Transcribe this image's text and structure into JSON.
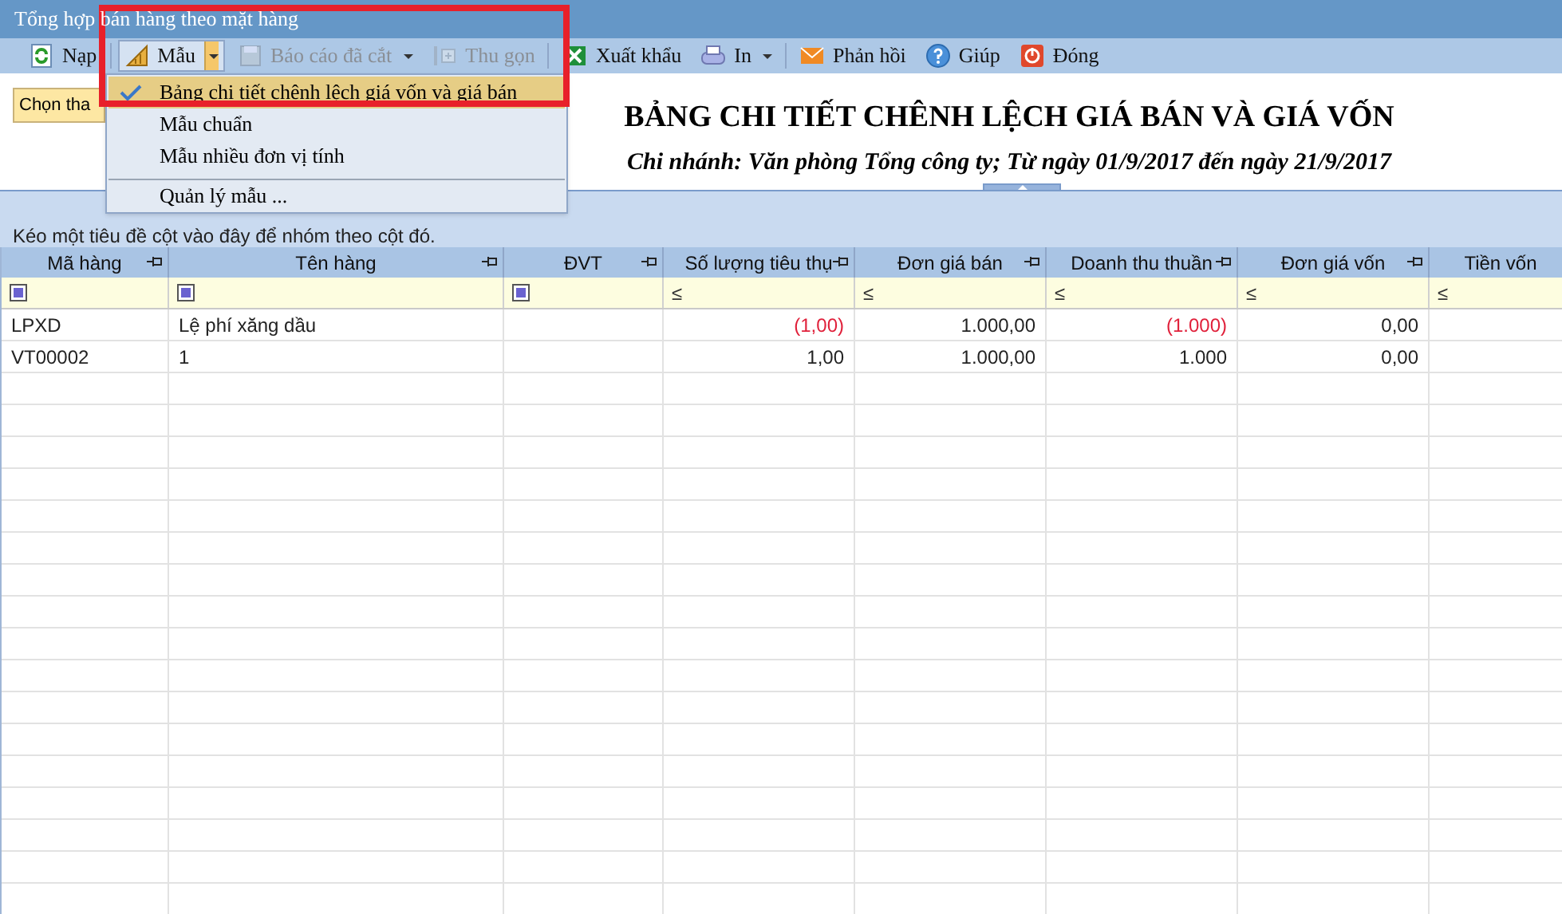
{
  "window": {
    "title": "Tổng hợp bán hàng theo mặt hàng"
  },
  "toolbar": [
    {
      "kind": "refresh",
      "label": "Nạp",
      "disabled": false,
      "pressed": false,
      "dropdown": false
    },
    {
      "kind": "template",
      "label": "Mẫu",
      "disabled": false,
      "pressed": true,
      "dropdown": true
    },
    {
      "kind": "save",
      "label": "Báo cáo đã cắt",
      "disabled": true,
      "pressed": false,
      "dropdown": true
    },
    {
      "kind": "collapse",
      "label": "Thu gọn",
      "disabled": true,
      "pressed": false,
      "dropdown": false
    },
    {
      "kind": "excel",
      "label": "Xuất khẩu",
      "disabled": false,
      "pressed": false,
      "dropdown": false
    },
    {
      "kind": "print",
      "label": "In",
      "disabled": false,
      "pressed": false,
      "dropdown": true
    },
    {
      "kind": "mail",
      "label": "Phản hồi",
      "disabled": false,
      "pressed": false,
      "dropdown": false
    },
    {
      "kind": "help",
      "label": "Giúp",
      "disabled": false,
      "pressed": false,
      "dropdown": false
    },
    {
      "kind": "close",
      "label": "Đóng",
      "disabled": false,
      "pressed": false,
      "dropdown": false
    }
  ],
  "template_menu": {
    "items": [
      {
        "label": "Bảng chi tiết chênh lệch giá vốn và giá bán",
        "selected": true,
        "separator_before": false
      },
      {
        "label": "Mẫu chuẩn",
        "selected": false,
        "separator_before": false
      },
      {
        "label": "Mẫu nhiều đơn vị tính",
        "selected": false,
        "separator_before": false
      },
      {
        "label": "Quản lý mẫu ...",
        "selected": false,
        "separator_before": true
      }
    ]
  },
  "parameters_button": {
    "label": "Chọn tha"
  },
  "report": {
    "title": "BẢNG CHI TIẾT CHÊNH LỆCH GIÁ BÁN VÀ GIÁ VỐN",
    "subtitle": "Chi nhánh: Văn phòng Tổng công ty; Từ ngày 01/9/2017 đến ngày 21/9/2017"
  },
  "group_panel": {
    "hint": "Kéo một tiêu đề cột vào đây để nhóm theo cột đó."
  },
  "table": {
    "columns": [
      {
        "label": "Mã hàng",
        "pin": true,
        "filter": {
          "kind": "square"
        }
      },
      {
        "label": "Tên hàng",
        "pin": true,
        "filter": {
          "kind": "square"
        }
      },
      {
        "label": "ĐVT",
        "pin": true,
        "filter": {
          "kind": "square"
        }
      },
      {
        "label": "Số lượng tiêu thụ",
        "pin": true,
        "filter": {
          "kind": "operator",
          "text": "≤"
        }
      },
      {
        "label": "Đơn giá bán",
        "pin": true,
        "filter": {
          "kind": "operator",
          "text": "≤"
        }
      },
      {
        "label": "Doanh thu thuần",
        "pin": true,
        "filter": {
          "kind": "operator",
          "text": "≤"
        }
      },
      {
        "label": "Đơn giá vốn",
        "pin": true,
        "filter": {
          "kind": "operator",
          "text": "≤"
        }
      },
      {
        "label": "Tiền vốn",
        "pin": false,
        "filter": {
          "kind": "operator",
          "text": "≤"
        }
      }
    ],
    "rows": [
      {
        "cells": [
          {
            "text": "LPXD",
            "negative": false
          },
          {
            "text": "Lệ phí xăng dầu",
            "negative": false
          },
          null,
          {
            "text": "(1,00)",
            "negative": true
          },
          {
            "text": "1.000,00",
            "negative": false
          },
          {
            "text": "(1.000)",
            "negative": true
          },
          {
            "text": "0,00",
            "negative": false
          },
          null
        ]
      },
      {
        "cells": [
          {
            "text": "VT00002",
            "negative": false
          },
          {
            "text": "1",
            "negative": false
          },
          null,
          {
            "text": "1,00",
            "negative": false
          },
          {
            "text": "1.000,00",
            "negative": false
          },
          {
            "text": "1.000",
            "negative": false
          },
          {
            "text": "0,00",
            "negative": false
          },
          null
        ]
      }
    ]
  }
}
